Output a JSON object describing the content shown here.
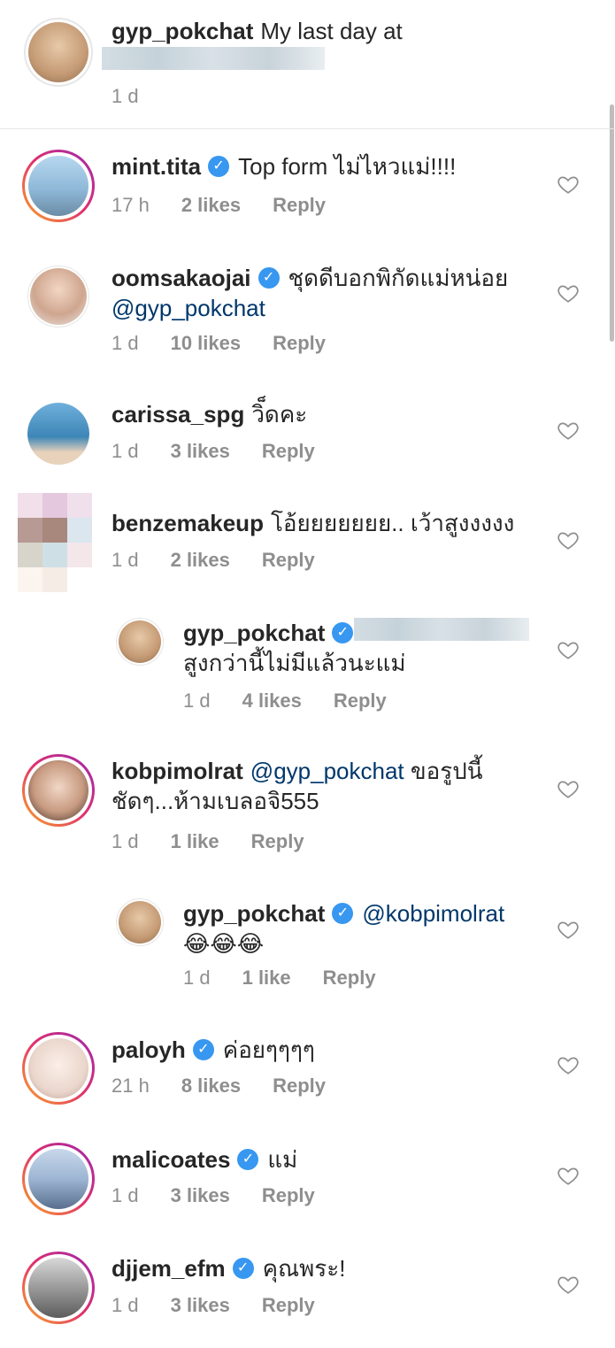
{
  "caption": {
    "username": "gyp_pokchat",
    "text": "My last day at",
    "time": "1 d"
  },
  "comments": [
    {
      "username": "mint.tita",
      "verified": true,
      "text": "Top form ไม่ไหวแม่!!!!",
      "time": "17 h",
      "likes": "2 likes",
      "reply": "Reply"
    },
    {
      "username": "oomsakaojai",
      "verified": true,
      "text": "ชุดดีบอกพิกัดแม่หน่อย",
      "mention": "@gyp_pokchat",
      "time": "1 d",
      "likes": "10 likes",
      "reply": "Reply"
    },
    {
      "username": "carissa_spg",
      "verified": false,
      "text": "วิ็ดคะ",
      "time": "1 d",
      "likes": "3 likes",
      "reply": "Reply"
    },
    {
      "username": "benzemakeup",
      "verified": false,
      "text": "โอ้ยยยยยยย.. เว้าสูงงงงง",
      "time": "1 d",
      "likes": "2 likes",
      "reply": "Reply"
    },
    {
      "username": "gyp_pokchat",
      "verified": true,
      "text": "สูงกว่านี้ไม่มีแล้วนะแม่",
      "time": "1 d",
      "likes": "4 likes",
      "reply": "Reply"
    },
    {
      "username": "kobpimolrat",
      "verified": false,
      "mention": "@gyp_pokchat",
      "text": "ขอรูปนี้",
      "text2": "ชัดๆ...ห้ามเบลอจิ555",
      "time": "1 d",
      "likes": "1 like",
      "reply": "Reply"
    },
    {
      "username": "gyp_pokchat",
      "verified": true,
      "mention": "@kobpimolrat",
      "text": "😂😂😂",
      "time": "1 d",
      "likes": "1 like",
      "reply": "Reply"
    },
    {
      "username": "paloyh",
      "verified": true,
      "text": "ค่อยๆๆๆๆ",
      "time": "21 h",
      "likes": "8 likes",
      "reply": "Reply"
    },
    {
      "username": "malicoates",
      "verified": true,
      "text": "แม่",
      "time": "1 d",
      "likes": "3 likes",
      "reply": "Reply"
    },
    {
      "username": "djjem_efm",
      "verified": true,
      "text": "คุณพระ!",
      "time": "1 d",
      "likes": "3 likes",
      "reply": "Reply"
    }
  ],
  "icons": {
    "heart": "heart-outline-icon",
    "verified": "verified-badge-icon"
  },
  "colors": {
    "verified": "#3897f0",
    "mention": "#00376b",
    "meta": "#8e8e8e"
  }
}
